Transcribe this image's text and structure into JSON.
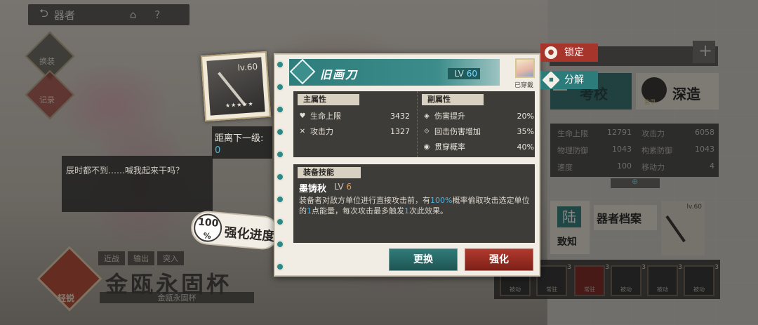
{
  "nav": {
    "back_label": "器者"
  },
  "side_buttons": {
    "swap": "换装",
    "history": "记录"
  },
  "dialog": {
    "text": "辰时都不到……喊我起来干吗？"
  },
  "bottom_left": {
    "tags": [
      "近战",
      "输出",
      "突入"
    ],
    "emblem_label": "轻锐",
    "title": "金瓯永固杯",
    "subtitle": "金瓯永固杯"
  },
  "weapon_card": {
    "level": "lv.60"
  },
  "distance": {
    "label": "距离下一级:",
    "value": "0"
  },
  "progress": {
    "percent": "100",
    "unit": "%",
    "label": "强化进度"
  },
  "equipment": {
    "name": "旧画刀",
    "lv_prefix": "LV",
    "lv_value": "60",
    "equipped_label": "已穿戴"
  },
  "main_attrs": {
    "title": "主属性",
    "rows": [
      {
        "icon": "heart-icon",
        "name": "生命上限",
        "value": "3432"
      },
      {
        "icon": "swords-icon",
        "name": "攻击力",
        "value": "1327"
      }
    ]
  },
  "sub_attrs": {
    "title": "副属性",
    "rows": [
      {
        "icon": "damage-up-icon",
        "name": "伤害提升",
        "value": "20%"
      },
      {
        "icon": "counter-icon",
        "name": "回击伤害增加",
        "value": "35%"
      },
      {
        "icon": "pierce-icon",
        "name": "贯穿概率",
        "value": "40%"
      }
    ]
  },
  "skill": {
    "title": "装备技能",
    "name": "墨铸秋",
    "lv_prefix": "LV",
    "lv_value": "6",
    "desc_1": "装备者对敌方单位进行直接攻击前，有",
    "desc_hl1": "100%",
    "desc_2": "概率偷取攻击选定单位的",
    "desc_hl2": "1",
    "desc_3": "点能量，每次攻击最多触发",
    "desc_hl3": "1",
    "desc_4": "次此效果。"
  },
  "buttons": {
    "replace": "更换",
    "enhance": "强化"
  },
  "side_tabs": {
    "lock": "锁定",
    "decompose": "分解"
  },
  "right_panel": {
    "research": "研",
    "research_text": "考校",
    "deep": "深造",
    "deep_badge": "紫甲",
    "stats": [
      {
        "name": "生命上限",
        "value": "12791"
      },
      {
        "name": "攻击力",
        "value": "6058"
      },
      {
        "name": "物理防御",
        "value": "1043"
      },
      {
        "name": "构素防御",
        "value": "1043"
      },
      {
        "name": "速度",
        "value": "100"
      },
      {
        "name": "移动力",
        "value": "4"
      }
    ],
    "archive_char": "陆",
    "archive_label": "致知",
    "archive_title": "器者档案",
    "weapon_lv": "lv.60",
    "skills": [
      {
        "label": "常驻",
        "count": "3"
      },
      {
        "label": "常驻",
        "count": "3"
      },
      {
        "label": "被动",
        "count": "3"
      },
      {
        "label": "被动",
        "count": "3"
      },
      {
        "label": "被动",
        "count": "3"
      },
      {
        "label": "被动",
        "count": "3"
      }
    ]
  }
}
